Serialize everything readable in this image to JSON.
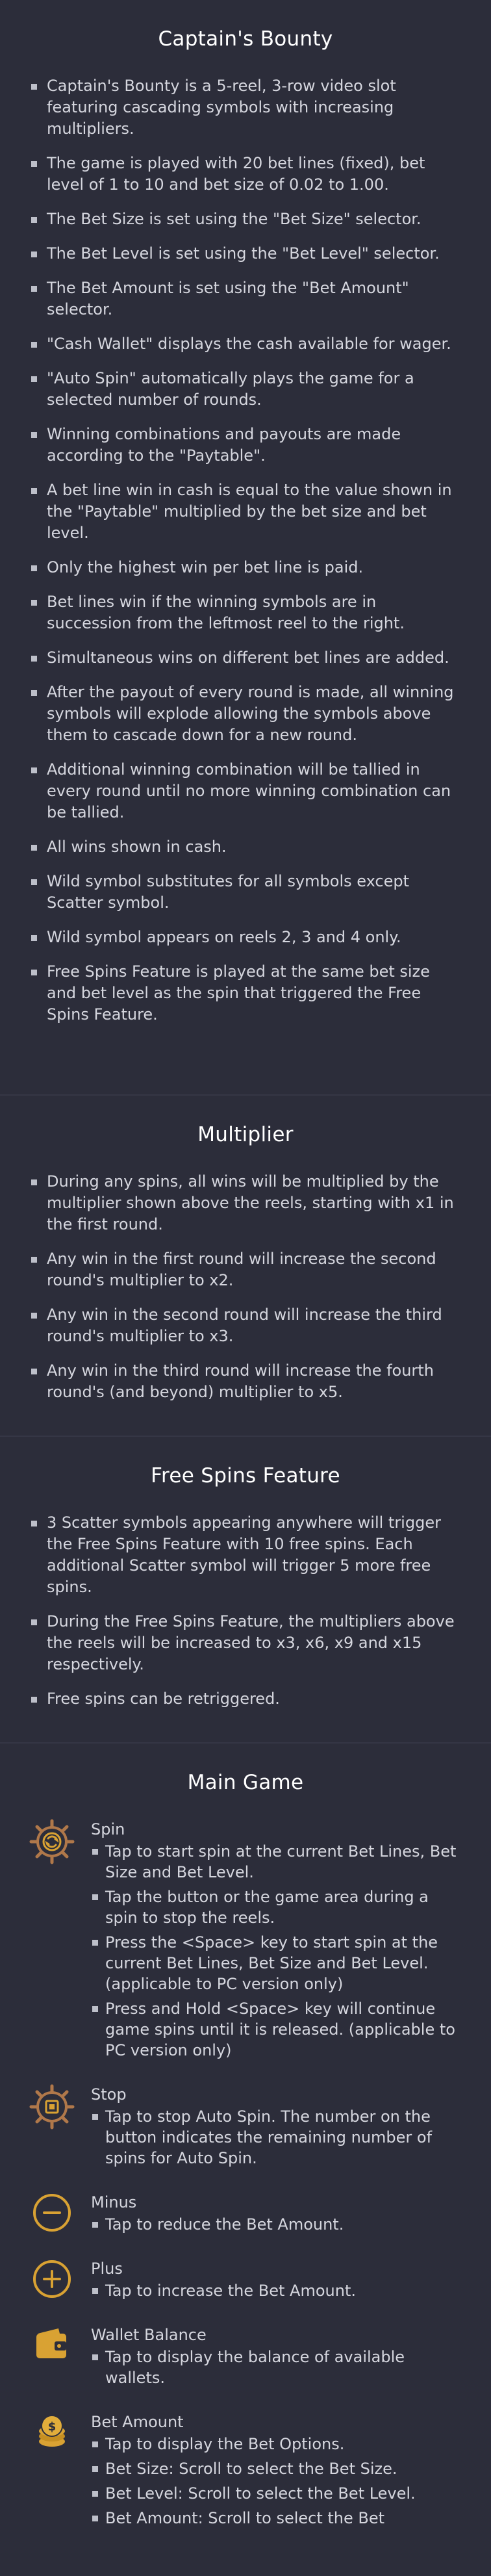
{
  "sections": [
    {
      "title": "Captain's Bounty",
      "items": [
        "Captain's Bounty is a 5-reel, 3-row video slot featuring cascading symbols with increasing multipliers.",
        "The game is played with 20 bet lines (fixed), bet level of 1 to 10 and bet size of 0.02 to 1.00.",
        "The Bet Size is set using the \"Bet Size\" selector.",
        "The Bet Level is set using the \"Bet Level\" selector.",
        "The Bet Amount is set using the \"Bet Amount\" selector.",
        "\"Cash Wallet\" displays the cash available for wager.",
        "\"Auto Spin\" automatically plays the game for a selected number of rounds.",
        "Winning combinations and payouts are made according to the \"Paytable\".",
        "A bet line win in cash is equal to the value shown in the \"Paytable\" multiplied by the bet size and bet level.",
        "Only the highest win per bet line is paid.",
        "Bet lines win if the winning symbols are in succession from the leftmost reel to the right.",
        "Simultaneous wins on different bet lines are added.",
        "After the payout of every round is made, all winning symbols will explode allowing the symbols above them to cascade down for a new round.",
        "Additional winning combination will be tallied in every round until no more winning combination can be tallied.",
        "All wins shown in cash.",
        "Wild symbol substitutes for all symbols except Scatter symbol.",
        "Wild symbol appears on reels 2, 3 and 4 only.",
        "Free Spins Feature is played at the same bet size and bet level as the spin that triggered the Free Spins Feature."
      ]
    },
    {
      "title": "Multiplier",
      "items": [
        "During any spins, all wins will be multiplied by the multiplier shown above the reels, starting with x1 in the first round.",
        "Any win in the first round will increase the second round's multiplier to x2.",
        "Any win in the second round will increase the third round's multiplier to x3.",
        "Any win in the third round will increase the fourth round's (and beyond) multiplier to x5."
      ]
    },
    {
      "title": "Free Spins Feature",
      "items": [
        "3 Scatter symbols appearing anywhere will trigger the Free Spins Feature with 10 free spins. Each additional Scatter symbol will trigger 5 more free spins.",
        "During the Free Spins Feature, the multipliers above the reels will be increased to x3, x6, x9 and x15 respectively.",
        "Free spins can be retriggered."
      ]
    }
  ],
  "main_game": {
    "title": "Main Game",
    "buttons": [
      {
        "icon": "spin-wheel-icon",
        "name": "Spin",
        "items": [
          "Tap to start spin at the current Bet Lines, Bet Size and Bet Level.",
          "Tap the button or the game area during a spin to stop the reels.",
          "Press the <Space> key to start spin at the current Bet Lines, Bet Size and Bet Level. (applicable to PC version only)",
          "Press and Hold <Space> key will continue game spins until it is released. (applicable to PC version only)"
        ]
      },
      {
        "icon": "stop-wheel-icon",
        "name": "Stop",
        "items": [
          "Tap to stop Auto Spin. The number on the button indicates the remaining number of spins for Auto Spin."
        ]
      },
      {
        "icon": "minus-circle-icon",
        "name": "Minus",
        "items": [
          "Tap to reduce the Bet Amount."
        ]
      },
      {
        "icon": "plus-circle-icon",
        "name": "Plus",
        "items": [
          "Tap to increase the Bet Amount."
        ]
      },
      {
        "icon": "wallet-icon",
        "name": "Wallet Balance",
        "items": [
          "Tap to display the balance of available wallets."
        ]
      },
      {
        "icon": "coin-stack-icon",
        "name": "Bet Amount",
        "items": [
          "Tap to display the Bet Options.",
          "Bet Size: Scroll to select the Bet Size.",
          "Bet Level: Scroll to select the Bet Level.",
          "Bet Amount: Scroll to select the Bet"
        ]
      }
    ]
  },
  "colors": {
    "background": "#2c2d3a",
    "heading": "#ffffff",
    "text": "#d5d6de",
    "icon_gold": "#d9a233",
    "icon_bronze": "#b0784a"
  }
}
